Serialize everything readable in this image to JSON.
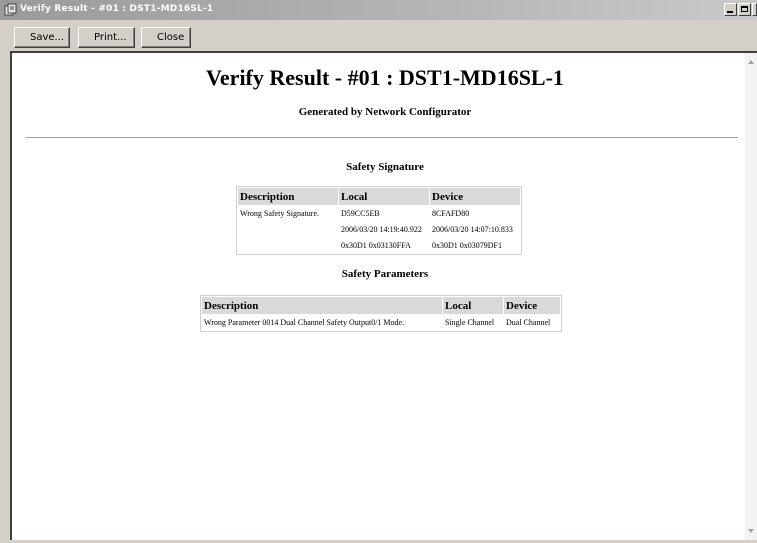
{
  "window": {
    "title": "Verify Result - #01 : DST1-MD16SL-1",
    "app_icon": "app-icon",
    "minimize_icon": "minimize-icon",
    "maximize_icon": "maximize-icon",
    "close_icon": "close-icon"
  },
  "toolbar": {
    "save_label": "Save...",
    "print_label": "Print...",
    "close_label": "Close"
  },
  "report": {
    "title": "Verify Result - #01 : DST1-MD16SL-1",
    "subtitle": "Generated by Network Configurator",
    "safety_signature": {
      "heading": "Safety Signature",
      "columns": [
        "Description",
        "Local",
        "Device"
      ],
      "description": "Wrong Safety Signature.",
      "rows": [
        [
          "D59CC5EB",
          "8CFAFD80"
        ],
        [
          "2006/03/20 14:19:40.922",
          "2006/03/20 14:07:10.833"
        ],
        [
          "0x30D1 0x03130FFA",
          "0x30D1 0x03079DF1"
        ]
      ]
    },
    "safety_parameters": {
      "heading": "Safety Parameters",
      "columns": [
        "Description",
        "Local",
        "Device"
      ],
      "rows": [
        [
          "Wrong Parameter 0014 Dual Channel Safety Output0/1 Mode.",
          "Single Channel",
          "Dual Channel"
        ]
      ]
    }
  }
}
